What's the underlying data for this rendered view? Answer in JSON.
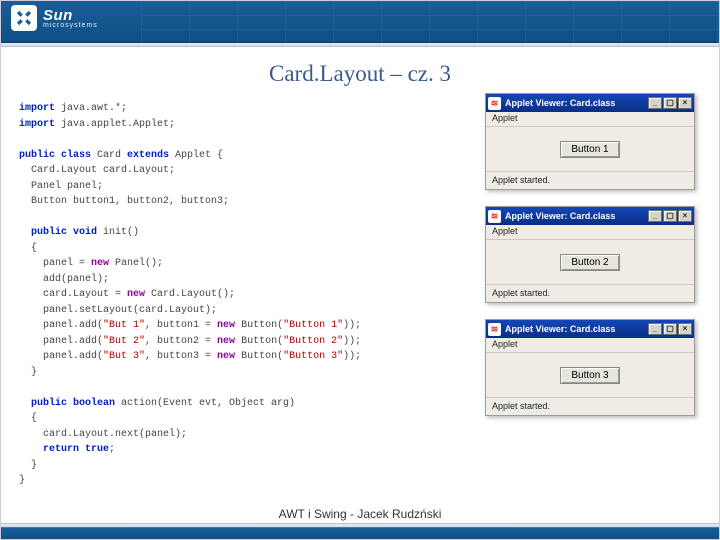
{
  "header": {
    "brand": "Sun",
    "sub": "microsystems"
  },
  "title": "Card.Layout – cz. 3",
  "code": {
    "l1a": "import",
    "l1b": " java.awt.*;",
    "l2a": "import",
    "l2b": " java.applet.Applet;",
    "l3a": "public class",
    "l3b": " Card ",
    "l3c": "extends",
    "l3d": " Applet {",
    "l4": "  Card.Layout card.Layout;",
    "l5": "  Panel panel;",
    "l6": "  Button button1, button2, button3;",
    "l7a": "  public void",
    "l7b": " init()",
    "l8": "  {",
    "l9a": "    panel = ",
    "l9b": "new",
    "l9c": " Panel();",
    "l10": "    add(panel);",
    "l11a": "    card.Layout = ",
    "l11b": "new",
    "l11c": " Card.Layout();",
    "l12": "    panel.setLayout(card.Layout);",
    "l13a": "    panel.add(",
    "l13s1": "\"But 1\"",
    "l13b": ", button1 = ",
    "l13c": "new",
    "l13d": " Button(",
    "l13s2": "\"Button 1\"",
    "l13e": "));",
    "l14a": "    panel.add(",
    "l14s1": "\"But 2\"",
    "l14b": ", button2 = ",
    "l14c": "new",
    "l14d": " Button(",
    "l14s2": "\"Button 2\"",
    "l14e": "));",
    "l15a": "    panel.add(",
    "l15s1": "\"But 3\"",
    "l15b": ", button3 = ",
    "l15c": "new",
    "l15d": " Button(",
    "l15s2": "\"Button 3\"",
    "l15e": "));",
    "l16": "  }",
    "l17a": "  public boolean",
    "l17b": " action(Event evt, Object arg)",
    "l18": "  {",
    "l19": "    card.Layout.next(panel);",
    "l20a": "    return true",
    "l20b": ";",
    "l21": "  }",
    "l22": "}"
  },
  "applets": [
    {
      "title": "Applet Viewer: Card.class",
      "menu": "Applet",
      "button": "Button 1",
      "status": "Applet started."
    },
    {
      "title": "Applet Viewer: Card.class",
      "menu": "Applet",
      "button": "Button 2",
      "status": "Applet started."
    },
    {
      "title": "Applet Viewer: Card.class",
      "menu": "Applet",
      "button": "Button 3",
      "status": "Applet started."
    }
  ],
  "footer": "AWT i Swing - Jacek Rudzński"
}
